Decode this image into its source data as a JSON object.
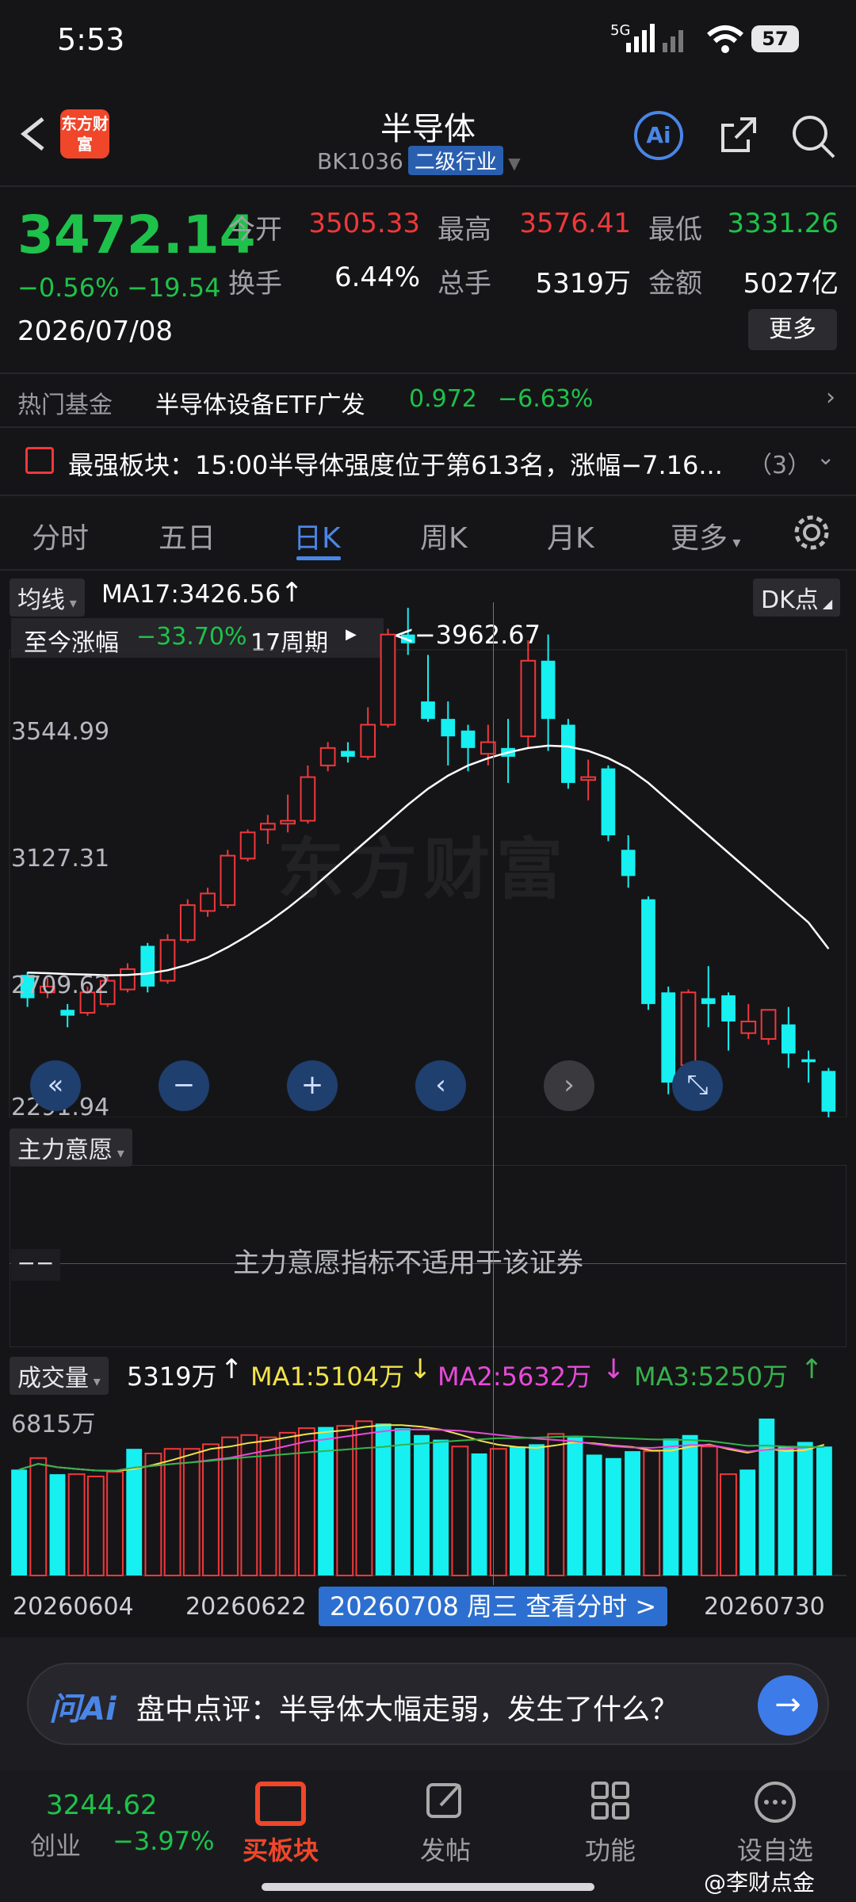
{
  "status": {
    "time": "5:53",
    "signal": "5G",
    "battery": "57"
  },
  "nav": {
    "title": "半导体",
    "code": "BK1036",
    "tag": "二级行业"
  },
  "quote": {
    "price": "3472.14",
    "change_pct": "−0.56%",
    "change": "−19.54",
    "date": "2026/07/08",
    "open_label": "今开",
    "open": "3505.33",
    "high_label": "最高",
    "high": "3576.41",
    "low_label": "最低",
    "low": "3331.26",
    "turnover_label": "换手",
    "turnover": "6.44%",
    "volume_label": "总手",
    "volume": "5319万",
    "amount_label": "金额",
    "amount": "5027亿",
    "more": "更多"
  },
  "hot_fund": {
    "label": "热门基金",
    "name": "半导体设备ETF广发",
    "price": "0.972",
    "pct": "−6.63%"
  },
  "notice": {
    "text": "最强板块：15:00半导体强度位于第613名，涨幅−7.16...",
    "count": "（3）"
  },
  "tabs": [
    "分时",
    "五日",
    "日K",
    "周K",
    "月K",
    "更多"
  ],
  "chart": {
    "ma_chip": "均线",
    "ma_text": "MA17:3426.56",
    "dk": "DK点",
    "since_label": "至今涨幅",
    "since_pct": "−33.70%",
    "period": "17周期",
    "peak": "<−3962.67",
    "y_labels": [
      "3544.99",
      "3127.31",
      "2709.62",
      "2291.94"
    ],
    "indicator_chip": "主力意愿",
    "indicator_msg": "主力意愿指标不适用于该证券",
    "indicator_dash": "−−",
    "vol_chip": "成交量",
    "vol": "5319万",
    "ma1": "MA1:5104万",
    "ma2": "MA2:5632万",
    "ma3": "MA3:5250万",
    "vol_ylab": "6815万",
    "dates": [
      "20260604",
      "20260622",
      "20260730"
    ],
    "cursor": "20260708 周三 查看分时 >",
    "colors": {
      "up": "#f0383a",
      "down": "#16f0f0",
      "ma1": "#f2e34a",
      "ma2": "#e84ad8",
      "ma3": "#37b24d"
    }
  },
  "chart_data": {
    "type": "candlestick",
    "y_ticks": [
      3544.99,
      3127.31,
      2709.62,
      2291.94
    ],
    "candles": [
      {
        "o": 2700,
        "c": 2620,
        "h": 2710,
        "l": 2590
      },
      {
        "o": 2640,
        "c": 2660,
        "h": 2690,
        "l": 2620
      },
      {
        "o": 2580,
        "c": 2560,
        "h": 2600,
        "l": 2520
      },
      {
        "o": 2570,
        "c": 2640,
        "h": 2660,
        "l": 2560
      },
      {
        "o": 2600,
        "c": 2680,
        "h": 2700,
        "l": 2590
      },
      {
        "o": 2650,
        "c": 2720,
        "h": 2740,
        "l": 2640
      },
      {
        "o": 2800,
        "c": 2660,
        "h": 2810,
        "l": 2640
      },
      {
        "o": 2680,
        "c": 2820,
        "h": 2840,
        "l": 2670
      },
      {
        "o": 2820,
        "c": 2940,
        "h": 2960,
        "l": 2810
      },
      {
        "o": 2920,
        "c": 2980,
        "h": 3000,
        "l": 2900
      },
      {
        "o": 2940,
        "c": 3110,
        "h": 3130,
        "l": 2930
      },
      {
        "o": 3100,
        "c": 3190,
        "h": 3200,
        "l": 3090
      },
      {
        "o": 3200,
        "c": 3220,
        "h": 3250,
        "l": 3150
      },
      {
        "o": 3220,
        "c": 3230,
        "h": 3320,
        "l": 3190
      },
      {
        "o": 3230,
        "c": 3380,
        "h": 3420,
        "l": 3220
      },
      {
        "o": 3420,
        "c": 3480,
        "h": 3500,
        "l": 3400
      },
      {
        "o": 3470,
        "c": 3450,
        "h": 3500,
        "l": 3430
      },
      {
        "o": 3450,
        "c": 3560,
        "h": 3620,
        "l": 3440
      },
      {
        "o": 3560,
        "c": 3870,
        "h": 3890,
        "l": 3550
      },
      {
        "o": 3870,
        "c": 3840,
        "h": 3962,
        "l": 3800
      },
      {
        "o": 3640,
        "c": 3580,
        "h": 3800,
        "l": 3570
      },
      {
        "o": 3580,
        "c": 3520,
        "h": 3640,
        "l": 3420
      },
      {
        "o": 3540,
        "c": 3480,
        "h": 3560,
        "l": 3400
      },
      {
        "o": 3460,
        "c": 3500,
        "h": 3560,
        "l": 3420
      },
      {
        "o": 3480,
        "c": 3450,
        "h": 3580,
        "l": 3360
      },
      {
        "o": 3520,
        "c": 3780,
        "h": 3850,
        "l": 3480
      },
      {
        "o": 3780,
        "c": 3580,
        "h": 3870,
        "l": 3470
      },
      {
        "o": 3560,
        "c": 3360,
        "h": 3580,
        "l": 3340
      },
      {
        "o": 3370,
        "c": 3380,
        "h": 3440,
        "l": 3300
      },
      {
        "o": 3410,
        "c": 3180,
        "h": 3420,
        "l": 3160
      },
      {
        "o": 3130,
        "c": 3040,
        "h": 3180,
        "l": 3000
      },
      {
        "o": 2960,
        "c": 2600,
        "h": 2970,
        "l": 2580
      },
      {
        "o": 2640,
        "c": 2330,
        "h": 2660,
        "l": 2290
      },
      {
        "o": 2390,
        "c": 2640,
        "h": 2650,
        "l": 2380
      },
      {
        "o": 2620,
        "c": 2600,
        "h": 2730,
        "l": 2520
      },
      {
        "o": 2630,
        "c": 2540,
        "h": 2640,
        "l": 2440
      },
      {
        "o": 2500,
        "c": 2540,
        "h": 2600,
        "l": 2480
      },
      {
        "o": 2480,
        "c": 2580,
        "h": 2580,
        "l": 2460
      },
      {
        "o": 2530,
        "c": 2430,
        "h": 2590,
        "l": 2380
      },
      {
        "o": 2410,
        "c": 2400,
        "h": 2440,
        "l": 2330
      },
      {
        "o": 2370,
        "c": 2230,
        "h": 2380,
        "l": 2200
      }
    ],
    "ma17": [
      2708,
      2706,
      2703,
      2701,
      2699,
      2700,
      2705,
      2716,
      2735,
      2760,
      2795,
      2835,
      2880,
      2930,
      2985,
      3045,
      3105,
      3165,
      3225,
      3285,
      3340,
      3385,
      3420,
      3445,
      3465,
      3480,
      3488,
      3485,
      3470,
      3445,
      3410,
      3360,
      3300,
      3240,
      3180,
      3120,
      3060,
      3000,
      2940,
      2880,
      2790
    ],
    "volumes": [
      4600,
      5100,
      4400,
      4400,
      4300,
      4500,
      5500,
      5300,
      5500,
      5500,
      5700,
      6000,
      6100,
      6000,
      6200,
      6400,
      6450,
      6500,
      6700,
      6600,
      6400,
      6100,
      5900,
      5600,
      5300,
      5500,
      5600,
      5700,
      6150,
      6000,
      5250,
      5100,
      5400,
      5400,
      5950,
      6100,
      5600,
      4400,
      4600,
      6815,
      5600,
      5800,
      5600
    ]
  },
  "ask": {
    "logo": "问Ai",
    "text": "盘中点评：半导体大幅走弱，发生了什么？"
  },
  "bottom": {
    "index_value": "3244.62",
    "index_name": "创业",
    "index_pct": "−3.97%",
    "tabs": [
      "买板块",
      "发帖",
      "功能",
      "设自选"
    ],
    "watermark": "@李财点金"
  },
  "brand": {
    "logo_text": "东方财富",
    "watermark": "东方财富"
  }
}
